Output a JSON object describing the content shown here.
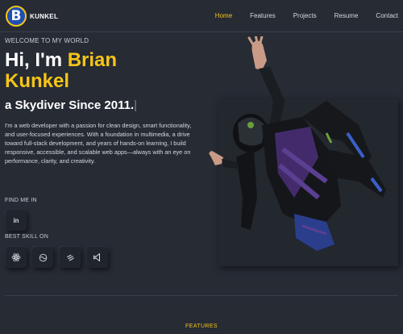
{
  "brand": {
    "letter": "B",
    "name": "KUNKEL"
  },
  "nav": [
    {
      "label": "Home",
      "active": true
    },
    {
      "label": "Features",
      "active": false
    },
    {
      "label": "Projects",
      "active": false
    },
    {
      "label": "Resume",
      "active": false
    },
    {
      "label": "Contact",
      "active": false
    }
  ],
  "hero": {
    "welcome": "WELCOME TO MY WORLD",
    "greeting": "Hi, I'm ",
    "first_name": "Brian",
    "last_name": "Kunkel",
    "subtitle": "a Skydiver Since 2011.",
    "cursor": "|",
    "bio": "I'm a web developer with a passion for clean design, smart functionality, and user-focused experiences. With a foundation in multimedia, a drive toward full-stack development, and years of hands-on learning, I build responsive, accessible, and scalable web apps—always with an eye on performance, clarity, and creativity."
  },
  "social": {
    "label": "FIND ME IN",
    "items": [
      {
        "icon": "linkedin-icon",
        "text": "in"
      }
    ]
  },
  "skills": {
    "label": "BEST SKILL ON",
    "items": [
      {
        "icon": "react-icon"
      },
      {
        "icon": "tailwind-icon"
      },
      {
        "icon": "stack-icon"
      },
      {
        "icon": "vscode-icon"
      }
    ]
  },
  "next_section": {
    "label": "FEATURES"
  },
  "colors": {
    "accent": "#f5c518",
    "background": "#262b34",
    "brand_blue": "#1f4fb4"
  }
}
